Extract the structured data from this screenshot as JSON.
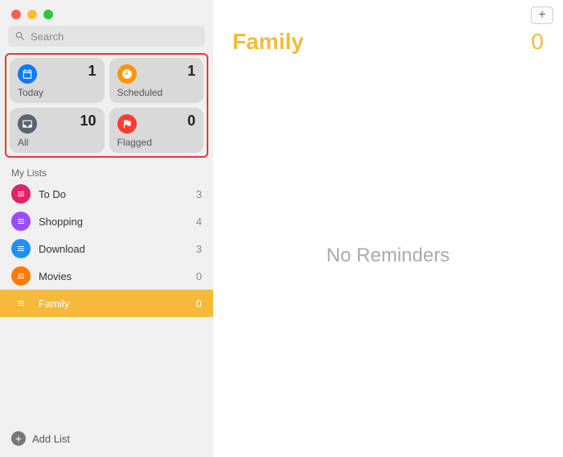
{
  "search": {
    "placeholder": "Search"
  },
  "smart": {
    "today": {
      "label": "Today",
      "count": "1",
      "color": "#0a7aff"
    },
    "scheduled": {
      "label": "Scheduled",
      "count": "1",
      "color": "#ff9500"
    },
    "all": {
      "label": "All",
      "count": "10",
      "color": "#5a6370"
    },
    "flagged": {
      "label": "Flagged",
      "count": "0",
      "color": "#ff3b30"
    }
  },
  "sectionTitle": "My Lists",
  "lists": [
    {
      "name": "To Do",
      "count": "3",
      "color": "#e2226b",
      "selected": false
    },
    {
      "name": "Shopping",
      "count": "4",
      "color": "#9a4dff",
      "selected": false
    },
    {
      "name": "Download",
      "count": "3",
      "color": "#1e90ff",
      "selected": false
    },
    {
      "name": "Movies",
      "count": "0",
      "color": "#ff7a00",
      "selected": false
    },
    {
      "name": "Family",
      "count": "0",
      "color": "#f6b93b",
      "selected": true
    }
  ],
  "addList": "Add List",
  "main": {
    "title": "Family",
    "count": "0",
    "empty": "No Reminders",
    "accent": "#f6b93b"
  }
}
